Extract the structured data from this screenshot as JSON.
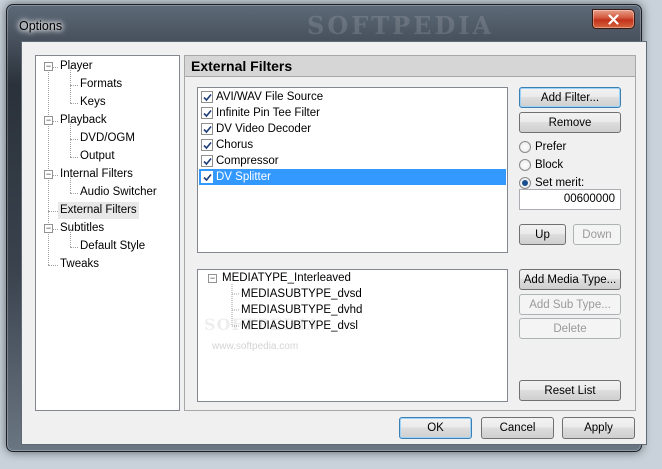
{
  "window": {
    "title": "Options",
    "watermark": "SOFTPEDIA"
  },
  "nav_tree": [
    {
      "label": "Player",
      "level": 0,
      "expanded": true
    },
    {
      "label": "Formats",
      "level": 1
    },
    {
      "label": "Keys",
      "level": 1
    },
    {
      "label": "Playback",
      "level": 0,
      "expanded": true
    },
    {
      "label": "DVD/OGM",
      "level": 1
    },
    {
      "label": "Output",
      "level": 1
    },
    {
      "label": "Internal Filters",
      "level": 0,
      "expanded": true
    },
    {
      "label": "Audio Switcher",
      "level": 1
    },
    {
      "label": "External Filters",
      "level": 0,
      "selected": true
    },
    {
      "label": "Subtitles",
      "level": 0,
      "expanded": true
    },
    {
      "label": "Default Style",
      "level": 1
    },
    {
      "label": "Tweaks",
      "level": 0
    }
  ],
  "panel": {
    "title": "External Filters"
  },
  "filters": [
    {
      "label": "AVI/WAV File Source",
      "checked": true
    },
    {
      "label": "Infinite Pin Tee Filter",
      "checked": true
    },
    {
      "label": "DV Video Decoder",
      "checked": true
    },
    {
      "label": "Chorus",
      "checked": true
    },
    {
      "label": "Compressor",
      "checked": true
    },
    {
      "label": "DV Splitter",
      "checked": true,
      "selected": true
    }
  ],
  "filter_buttons": {
    "add_filter": "Add Filter...",
    "remove": "Remove",
    "up": "Up",
    "down": "Down"
  },
  "merit": {
    "prefer": "Prefer",
    "block": "Block",
    "set_merit": "Set merit:",
    "selected": "set_merit",
    "value": "00600000"
  },
  "media_types": {
    "root": "MEDIATYPE_Interleaved",
    "children": [
      "MEDIASUBTYPE_dvsd",
      "MEDIASUBTYPE_dvhd",
      "MEDIASUBTYPE_dvsl"
    ],
    "watermark_text": "SOFTPEDIA",
    "watermark_url": "www.softpedia.com"
  },
  "type_buttons": {
    "add_media_type": "Add Media Type...",
    "add_sub_type": "Add Sub Type...",
    "delete": "Delete",
    "reset_list": "Reset List"
  },
  "dialog_buttons": {
    "ok": "OK",
    "cancel": "Cancel",
    "apply": "Apply"
  },
  "colors": {
    "selection": "#3399ff",
    "close_button": "#c2321a"
  }
}
